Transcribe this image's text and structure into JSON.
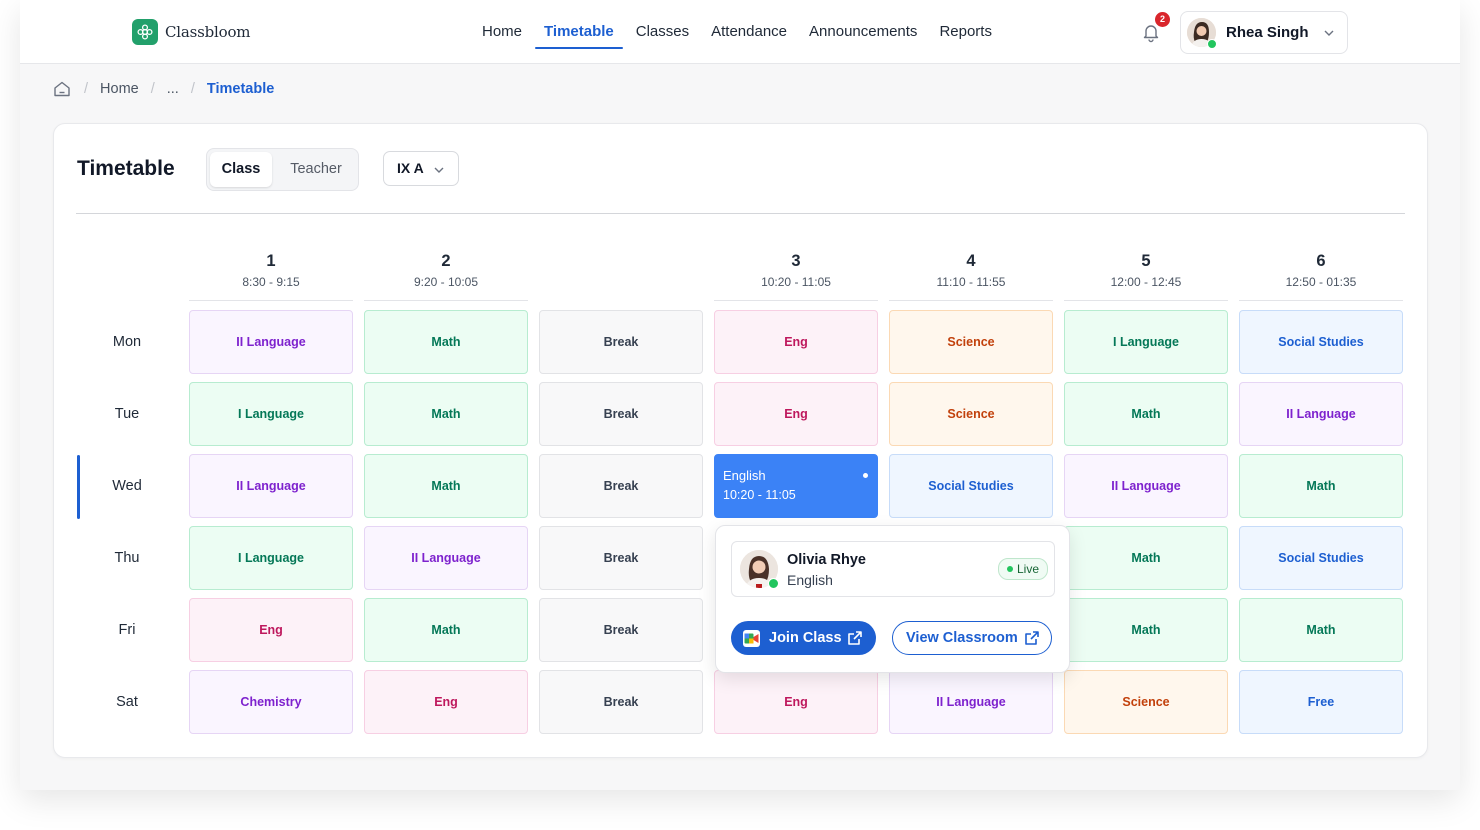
{
  "app": {
    "name": "Classbloom"
  },
  "nav": {
    "items": [
      {
        "label": "Home",
        "active": false
      },
      {
        "label": "Timetable",
        "active": true
      },
      {
        "label": "Classes",
        "active": false
      },
      {
        "label": "Attendance",
        "active": false
      },
      {
        "label": "Announcements",
        "active": false
      },
      {
        "label": "Reports",
        "active": false
      }
    ]
  },
  "notifications": {
    "count": "2"
  },
  "user": {
    "name": "Rhea Singh",
    "status": "online"
  },
  "breadcrumb": [
    {
      "label": "Home"
    },
    {
      "label": "..."
    },
    {
      "label": "Timetable",
      "current": true
    }
  ],
  "timetable": {
    "title": "Timetable",
    "view_toggle": {
      "options": [
        "Class",
        "Teacher"
      ],
      "selected": "Class"
    },
    "class_select": {
      "value": "IX A"
    },
    "columns": [
      {
        "num": "1",
        "time": "8:30 - 9:15"
      },
      {
        "num": "2",
        "time": "9:20 - 10:05"
      },
      {
        "num": "",
        "time": ""
      },
      {
        "num": "3",
        "time": "10:20 - 11:05"
      },
      {
        "num": "4",
        "time": "11:10 - 11:55"
      },
      {
        "num": "5",
        "time": "12:00 - 12:45"
      },
      {
        "num": "6",
        "time": "12:50 - 01:35"
      }
    ],
    "days": [
      "Mon",
      "Tue",
      "Wed",
      "Thu",
      "Fri",
      "Sat"
    ],
    "current_day": "Wed",
    "rows": [
      [
        "II Language",
        "Math",
        "Break",
        "Eng",
        "Science",
        "I Language",
        "Social Studies"
      ],
      [
        "I Language",
        "Math",
        "Break",
        "Eng",
        "Science",
        "Math",
        "II Language"
      ],
      [
        "II Language",
        "Math",
        "Break",
        "English",
        "Social Studies",
        "II Language",
        "Math"
      ],
      [
        "I Language",
        "II Language",
        "Break",
        "",
        "",
        "Math",
        "Social Studies"
      ],
      [
        "Eng",
        "Math",
        "Break",
        "",
        "",
        "Math",
        "Math"
      ],
      [
        "Chemistry",
        "Eng",
        "Break",
        "Eng",
        "II Language",
        "Science",
        "Free"
      ]
    ],
    "active_cell": {
      "subject": "English",
      "time": "10:20 - 11:05"
    }
  },
  "subject_colors": {
    "II Language": {
      "bg": "#faf5ff",
      "border": "#e6d5f5",
      "text": "#7e22ce"
    },
    "I Language": {
      "bg": "#ecfdf3",
      "border": "#b7ecd0",
      "text": "#047857"
    },
    "Math": {
      "bg": "#ecfdf3",
      "border": "#b7ecd0",
      "text": "#047857"
    },
    "Break": {
      "bg": "#f8f8f9",
      "border": "#e2e3e6",
      "text": "#374151"
    },
    "Eng": {
      "bg": "#fdf2f8",
      "border": "#f7cfe3",
      "text": "#be185d"
    },
    "Science": {
      "bg": "#fff7ed",
      "border": "#fbd9b4",
      "text": "#c2410c"
    },
    "Social Studies": {
      "bg": "#eff6ff",
      "border": "#c7dcf9",
      "text": "#1d5fd1"
    },
    "Chemistry": {
      "bg": "#faf5ff",
      "border": "#e6d5f5",
      "text": "#7e22ce"
    },
    "Free": {
      "bg": "#eff6ff",
      "border": "#c7dcf9",
      "text": "#1d5fd1"
    }
  },
  "popover": {
    "teacher_name": "Olivia Rhye",
    "subject": "English",
    "status": "Live",
    "join_label": "Join Class",
    "view_label": "View Classroom"
  },
  "colors": {
    "accent": "#1d5fd1",
    "active_cell": "#3b82f6",
    "live": "#22c55e",
    "badge": "#d9262c"
  }
}
